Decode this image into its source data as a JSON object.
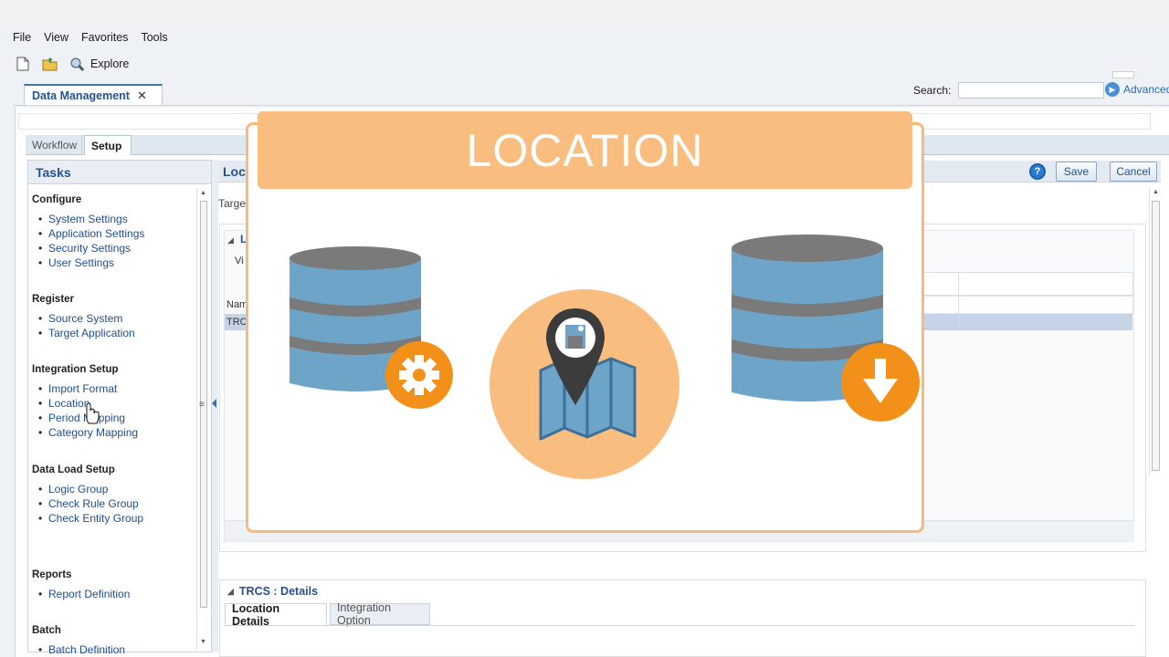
{
  "menu": {
    "items": [
      "File",
      "View",
      "Favorites",
      "Tools"
    ]
  },
  "toolbar": {
    "explore_label": "Explore"
  },
  "app_tab": {
    "label": "Data Management",
    "close": "✕"
  },
  "search": {
    "label": "Search:",
    "value": "",
    "advanced_label": "Advanced"
  },
  "workspace_tabs": {
    "workflow": "Workflow",
    "setup": "Setup"
  },
  "tasks": {
    "title": "Tasks",
    "groups": [
      {
        "title": "Configure",
        "items": [
          "System Settings",
          "Application Settings",
          "Security Settings",
          "User Settings"
        ]
      },
      {
        "title": "Register",
        "items": [
          "Source System",
          "Target Application"
        ]
      },
      {
        "title": "Integration Setup",
        "items": [
          "Import Format",
          "Location",
          "Period Mapping",
          "Category Mapping"
        ]
      },
      {
        "title": "Data Load Setup",
        "items": [
          "Logic Group",
          "Check Rule Group",
          "Check Entity Group"
        ]
      },
      {
        "title": "Reports",
        "items": [
          "Report Definition"
        ]
      },
      {
        "title": "Batch",
        "items": [
          "Batch Definition"
        ]
      }
    ]
  },
  "main": {
    "title_fragment": "Loc",
    "target_fragment": "Targe",
    "panel_fragment": "L",
    "view_fragment": "Vi",
    "name_fragment": "Nam",
    "row_fragment": "TRC",
    "save_label": "Save",
    "cancel_label": "Cancel",
    "help_glyph": "?"
  },
  "details": {
    "title": "TRCS : Details",
    "tabs": [
      "Location Details",
      "Integration Option"
    ]
  },
  "overlay": {
    "banner_text": "LOCATION",
    "colors": {
      "orange": "#f39019",
      "peach": "#f9bd7f",
      "db_blue": "#6fa4c9",
      "db_gray": "#7a7a7a",
      "pin": "#3c3c3c"
    },
    "icons": [
      "database-icon",
      "gear-icon",
      "map-pin-icon",
      "download-arrow-icon"
    ]
  }
}
